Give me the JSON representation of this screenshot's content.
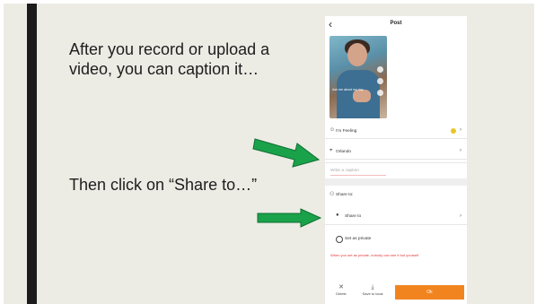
{
  "slide": {
    "text1": "After you record or upload a video, you can caption it…",
    "text2": "Then click on “Share to…”",
    "accent_color": "#1c1c1c",
    "arrow_color": "#1aa24a"
  },
  "phone": {
    "back_icon": "‹",
    "title": "Post",
    "thumbnail_caption": "Ask me about my day",
    "feeling_label": "I'm Feeling",
    "orlando_label": "Orlando",
    "caption_placeholder": "Write a caption",
    "share_header": "Share to:",
    "share_to_label": "Share to",
    "set_private_label": "Set as private",
    "warning_text": "When you set as private, nobody can see it but yourself",
    "delete_label": "Delete",
    "save_local_label": "Save to local",
    "post_button_label": "Ok",
    "accent_color": "#f2841f"
  }
}
